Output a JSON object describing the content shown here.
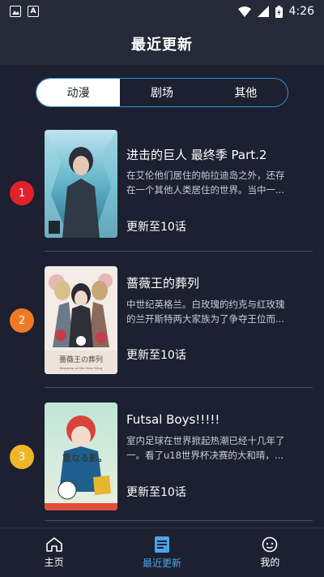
{
  "status_bar": {
    "time": "4:26"
  },
  "header": {
    "title": "最近更新"
  },
  "tabs": [
    {
      "label": "动漫",
      "active": true
    },
    {
      "label": "剧场",
      "active": false
    },
    {
      "label": "其他",
      "active": false
    }
  ],
  "items": [
    {
      "rank": "1",
      "rank_color": "#e3212a",
      "title": "进击的巨人 最终季 Part.2",
      "desc_line1": "在艾伦他们居住的帕拉迪岛之外，还存",
      "desc_line2": "在一个其他人类居住的世界。当中一...",
      "episode": "更新至10话"
    },
    {
      "rank": "2",
      "rank_color": "#f07a24",
      "title": "蔷薇王的葬列",
      "desc_line1": "中世纪英格兰。白玫瑰的约克与红玫瑰",
      "desc_line2": "的兰开斯特两大家族为了争夺王位而...",
      "episode": "更新至10话"
    },
    {
      "rank": "3",
      "rank_color": "#f0b62a",
      "title": "Futsal Boys!!!!!",
      "desc_line1": "室内足球在世界掀起热潮已经十几年了",
      "desc_line2": "一。看了u18世界杯决赛的大和晴，...",
      "episode": "更新至10话"
    }
  ],
  "bottom_nav": [
    {
      "label": "主页",
      "icon": "home-icon",
      "active": false
    },
    {
      "label": "最近更新",
      "icon": "updates-icon",
      "active": true
    },
    {
      "label": "我的",
      "icon": "profile-icon",
      "active": false
    }
  ],
  "colors": {
    "accent": "#4aa6e8",
    "background": "#1c2030",
    "tab_border": "#3a8fd0"
  }
}
